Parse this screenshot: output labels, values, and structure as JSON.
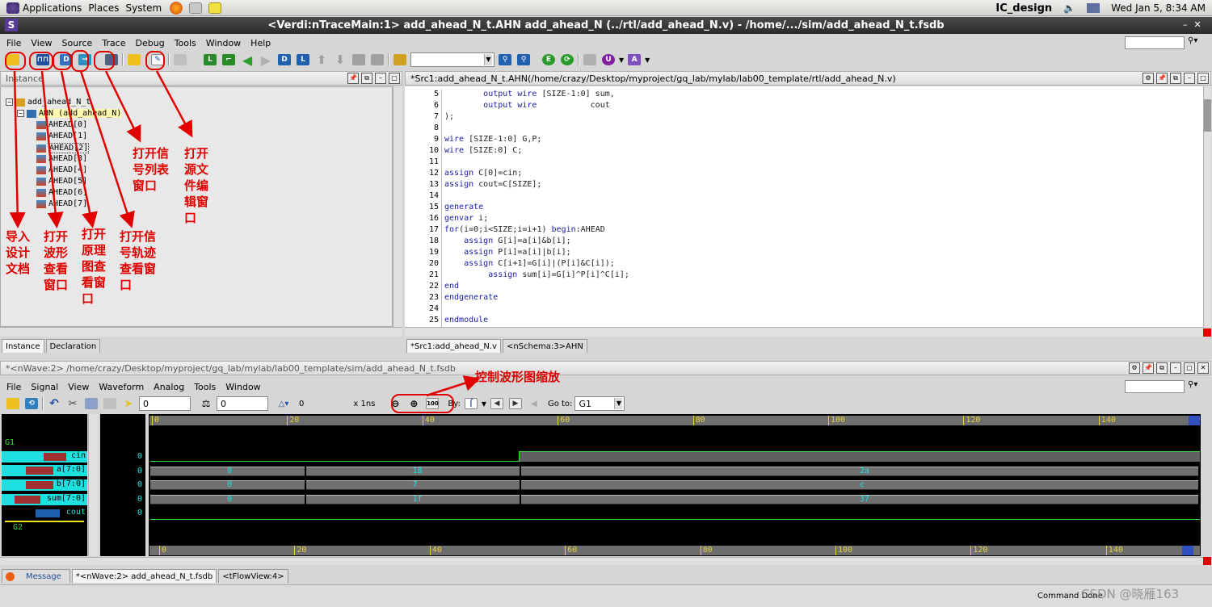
{
  "gnome_panel": {
    "applications": "Applications",
    "places": "Places",
    "system": "System",
    "hostname": "IC_design",
    "clock": "Wed Jan  5,  8:34 AM"
  },
  "window": {
    "title": "<Verdi:nTraceMain:1> add_ahead_N_t.AHN  add_ahead_N (../rtl/add_ahead_N.v) - /home/.../sim/add_ahead_N_t.fsdb"
  },
  "main_menu": [
    "File",
    "View",
    "Source",
    "Trace",
    "Debug",
    "Tools",
    "Window",
    "Help"
  ],
  "instance_panel": {
    "title": "Instance",
    "tree": [
      {
        "label": "add_ahead_N_t",
        "level": 0
      },
      {
        "label": "AHN (add_ahead_N)",
        "level": 1
      },
      {
        "label": "AHEAD[0]",
        "level": 2
      },
      {
        "label": "AHEAD[1]",
        "level": 2
      },
      {
        "label": "AHEAD[2]",
        "level": 2
      },
      {
        "label": "AHEAD[3]",
        "level": 2
      },
      {
        "label": "AHEAD[4]",
        "level": 2
      },
      {
        "label": "AHEAD[5]",
        "level": 2
      },
      {
        "label": "AHEAD[6]",
        "level": 2
      },
      {
        "label": "AHEAD[7]",
        "level": 2
      }
    ],
    "tabs": [
      "Instance",
      "Declaration"
    ]
  },
  "source_panel": {
    "title": "*Src1:add_ahead_N_t.AHN(/home/crazy/Desktop/myproject/gq_lab/mylab/lab00_template/rtl/add_ahead_N.v)",
    "lines": [
      {
        "n": "5",
        "code": "        output wire [SIZE-1:0] sum,"
      },
      {
        "n": "6",
        "code": "        output wire           cout"
      },
      {
        "n": "7",
        "code": ");"
      },
      {
        "n": "8",
        "code": ""
      },
      {
        "n": "9",
        "code": "wire [SIZE-1:0] G,P;"
      },
      {
        "n": "10",
        "code": "wire [SIZE:0] C;"
      },
      {
        "n": "11",
        "code": ""
      },
      {
        "n": "12",
        "code": "assign C[0]=cin;"
      },
      {
        "n": "13",
        "code": "assign cout=C[SIZE];"
      },
      {
        "n": "14",
        "code": ""
      },
      {
        "n": "15",
        "code": "generate"
      },
      {
        "n": "16",
        "code": "genvar i;"
      },
      {
        "n": "17",
        "code": "for(i=0;i<SIZE;i=i+1) begin:AHEAD"
      },
      {
        "n": "18",
        "code": "    assign G[i]=a[i]&b[i];"
      },
      {
        "n": "19",
        "code": "    assign P[i]=a[i]|b[i];"
      },
      {
        "n": "20",
        "code": "    assign C[i+1]=G[i]|(P[i]&C[i]);"
      },
      {
        "n": "21",
        "code": "         assign sum[i]=G[i]^P[i]^C[i];"
      },
      {
        "n": "22",
        "code": "end"
      },
      {
        "n": "23",
        "code": "endgenerate"
      },
      {
        "n": "24",
        "code": ""
      },
      {
        "n": "25",
        "code": "endmodule"
      }
    ],
    "tabs": [
      "*Src1:add_ahead_N.v",
      "<nSchema:3>AHN"
    ]
  },
  "nwave": {
    "title": "*<nWave:2> /home/crazy/Desktop/myproject/gq_lab/mylab/lab00_template/sim/add_ahead_N_t.fsdb",
    "menu": [
      "File",
      "Signal",
      "View",
      "Waveform",
      "Analog",
      "Tools",
      "Window"
    ],
    "cursor_field": "0",
    "marker_field": "0",
    "delta_value": "0",
    "time_unit": "x 1ns",
    "by_label": "By:",
    "goto_label": "Go to:",
    "goto_value": "G1",
    "groups": [
      "G1",
      "G2"
    ],
    "signals": [
      {
        "name": "cin",
        "value": "0"
      },
      {
        "name": "a[7:0]",
        "value": "0"
      },
      {
        "name": "b[7:0]",
        "value": "0"
      },
      {
        "name": "sum[7:0]",
        "value": "0"
      },
      {
        "name": "cout",
        "value": "0"
      }
    ],
    "ruler_ticks": [
      "0",
      "20",
      "40",
      "60",
      "80",
      "100",
      "120",
      "140"
    ],
    "bus_values": {
      "a": [
        "0",
        "18",
        "2a"
      ],
      "b": [
        "0",
        "7",
        "c"
      ],
      "sum": [
        "0",
        "1f",
        "37"
      ]
    }
  },
  "bottom_tabs": [
    "Message",
    "*<nWave:2> add_ahead_N_t.fsdb",
    "<tFlowView:4>"
  ],
  "status": {
    "command": "Command Done",
    "watermark": "CSDN @晓雁163"
  },
  "annotations": {
    "import_design": "导入\n设计\n文档",
    "open_wave": "打开\n波形\n查看\n窗口",
    "open_schematic": "打开\n原理\n图查\n看窗\n口",
    "open_signal_trace": "打开信\n号轨迹\n查看窗\n口",
    "open_signal_list": "打开信\n号列表\n窗口",
    "open_source_edit": "打开\n源文\n件编\n辑窗\n口",
    "zoom_control": "控制波形图缩放"
  }
}
